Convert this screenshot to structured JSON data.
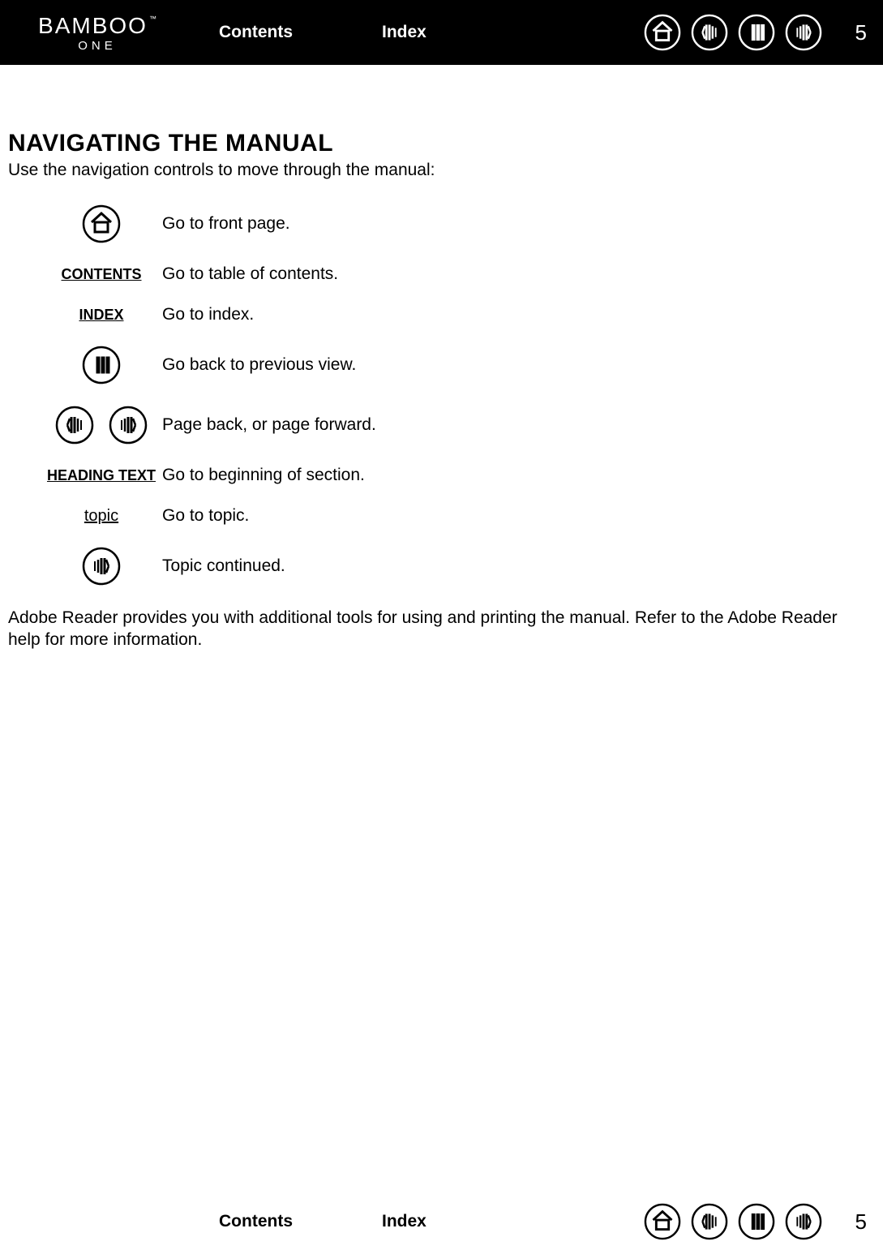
{
  "brand": {
    "name": "BAMBOO",
    "tm": "™",
    "sub": "ONE"
  },
  "nav": {
    "contents": "Contents",
    "index": "Index"
  },
  "page_number": "5",
  "section": {
    "title": "NAVIGATING THE MANUAL",
    "intro": "Use the navigation controls to move through the manual:",
    "rows": {
      "home": "Go to front page.",
      "contents_label": "CONTENTS",
      "contents_desc": "Go to table of contents.",
      "index_label": "INDEX",
      "index_desc": "Go to index.",
      "prev_view": "Go back to previous view.",
      "page_nav": "Page back, or page forward.",
      "heading_label": "HEADING TEXT",
      "heading_desc": "Go to beginning of section.",
      "topic_label": "topic",
      "topic_desc": "Go to topic.",
      "continued": "Topic continued."
    },
    "para": "Adobe Reader provides you with additional tools for using and printing the manual.  Refer to the Adobe Reader help for more information."
  }
}
